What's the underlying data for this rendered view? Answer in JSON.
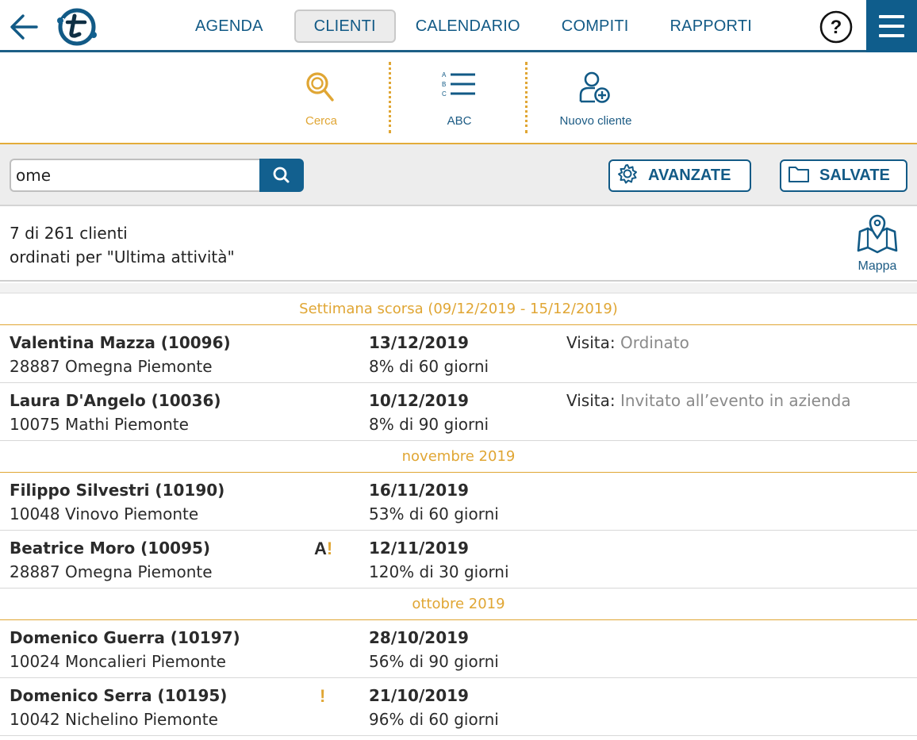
{
  "nav": {
    "tabs": [
      {
        "label": "AGENDA"
      },
      {
        "label": "CLIENTI"
      },
      {
        "label": "CALENDARIO"
      },
      {
        "label": "COMPITI"
      },
      {
        "label": "RAPPORTI"
      }
    ],
    "active_tab": "CLIENTI",
    "help_label": "?"
  },
  "tools": {
    "search_label": "Cerca",
    "abc_label": "ABC",
    "new_client_label": "Nuovo cliente",
    "abc_letters": [
      "A",
      "B",
      "C"
    ]
  },
  "search": {
    "value": "ome",
    "advanced_label": "AVANZATE",
    "saved_label": "SALVATE"
  },
  "summary": {
    "count_text": "7 di 261 clienti",
    "sort_text": "ordinati per \"Ultima attività\"",
    "map_label": "Mappa"
  },
  "groups": [
    {
      "title": "Settimana scorsa (09/12/2019 - 15/12/2019)",
      "rows": [
        {
          "name": "Valentina Mazza (10096)",
          "address": "28887 Omegna Piemonte",
          "date": "13/12/2019",
          "progress": "8% di 60 giorni",
          "activity_label": "Visita:",
          "activity_value": " Ordinato",
          "flag_a": "",
          "flag_ex": ""
        },
        {
          "name": "Laura D'Angelo (10036)",
          "address": "10075 Mathi Piemonte",
          "date": "10/12/2019",
          "progress": "8% di 90 giorni",
          "activity_label": "Visita:",
          "activity_value": " Invitato all’evento in azienda",
          "flag_a": "",
          "flag_ex": ""
        }
      ]
    },
    {
      "title": "novembre 2019",
      "rows": [
        {
          "name": "Filippo Silvestri (10190)",
          "address": "10048 Vinovo Piemonte",
          "date": "16/11/2019",
          "progress": "53% di 60 giorni",
          "activity_label": "",
          "activity_value": "",
          "flag_a": "",
          "flag_ex": ""
        },
        {
          "name": "Beatrice Moro (10095)",
          "address": "28887 Omegna Piemonte",
          "date": "12/11/2019",
          "progress": "120% di 30 giorni",
          "activity_label": "",
          "activity_value": "",
          "flag_a": "A",
          "flag_ex": "!"
        }
      ]
    },
    {
      "title": "ottobre 2019",
      "rows": [
        {
          "name": "Domenico Guerra (10197)",
          "address": "10024 Moncalieri Piemonte",
          "date": "28/10/2019",
          "progress": "56% di 90 giorni",
          "activity_label": "",
          "activity_value": "",
          "flag_a": "",
          "flag_ex": ""
        },
        {
          "name": "Domenico Serra (10195)",
          "address": "10042 Nichelino Piemonte",
          "date": "21/10/2019",
          "progress": "96% di 60 giorni",
          "activity_label": "",
          "activity_value": "",
          "flag_a": "",
          "flag_ex": "!"
        }
      ]
    }
  ],
  "colors": {
    "brand_blue": "#125a86",
    "accent_gold": "#e0a634",
    "muted_text": "#8a8a8a"
  },
  "icons": [
    "back-arrow-icon",
    "logo-icon",
    "help-icon",
    "hamburger-menu-icon",
    "magnifier-icon",
    "abc-list-icon",
    "add-user-icon",
    "search-icon",
    "gear-icon",
    "folder-icon",
    "map-pin-icon"
  ]
}
